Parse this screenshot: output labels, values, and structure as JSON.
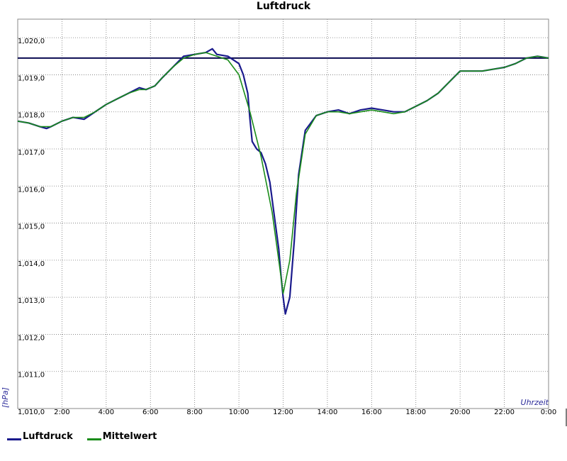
{
  "chart_data": {
    "type": "line",
    "title": "Luftdruck",
    "xlabel": "Uhrzeit",
    "ylabel": "[hPa]",
    "xlim": [
      0,
      24
    ],
    "ylim": [
      1010.0,
      1020.5
    ],
    "x_ticks": [
      {
        "value": 2,
        "label": "2:00"
      },
      {
        "value": 4,
        "label": "4:00"
      },
      {
        "value": 6,
        "label": "6:00"
      },
      {
        "value": 8,
        "label": "8:00"
      },
      {
        "value": 10,
        "label": "10:00"
      },
      {
        "value": 12,
        "label": "12:00"
      },
      {
        "value": 14,
        "label": "14:00"
      },
      {
        "value": 16,
        "label": "16:00"
      },
      {
        "value": 18,
        "label": "18:00"
      },
      {
        "value": 20,
        "label": "20:00"
      },
      {
        "value": 22,
        "label": "22:00"
      },
      {
        "value": 24,
        "label": "0:00"
      }
    ],
    "y_ticks": [
      {
        "value": 1010,
        "label": "1,010,0"
      },
      {
        "value": 1011,
        "label": "1,011,0"
      },
      {
        "value": 1012,
        "label": "1,012,0"
      },
      {
        "value": 1013,
        "label": "1,013,0"
      },
      {
        "value": 1014,
        "label": "1,014,0"
      },
      {
        "value": 1015,
        "label": "1,015,0"
      },
      {
        "value": 1016,
        "label": "1,016,0"
      },
      {
        "value": 1017,
        "label": "1,017,0"
      },
      {
        "value": 1018,
        "label": "1,018,0"
      },
      {
        "value": 1019,
        "label": "1,019,0"
      },
      {
        "value": 1020,
        "label": "1,020,0"
      }
    ],
    "grid": true,
    "reference_line": 1019.45,
    "legend_position": "bottom-left",
    "series": [
      {
        "name": "Luftdruck",
        "color": "#1a1a8c",
        "x": [
          0,
          0.5,
          1,
          1.3,
          1.5,
          2,
          2.5,
          3,
          3.5,
          4,
          4.5,
          5,
          5.5,
          5.8,
          6.2,
          6.5,
          7,
          7.5,
          8,
          8.5,
          8.8,
          9,
          9.5,
          10,
          10.2,
          10.4,
          10.5,
          10.6,
          10.8,
          11,
          11.2,
          11.4,
          11.6,
          11.8,
          11.9,
          12,
          12.1,
          12.3,
          12.5,
          12.7,
          13,
          13.5,
          14,
          14.5,
          15,
          15.5,
          16,
          16.5,
          17,
          17.5,
          18,
          18.5,
          19,
          19.5,
          20,
          20.5,
          21,
          21.5,
          22,
          22.5,
          23,
          23.5,
          24
        ],
        "y": [
          1017.75,
          1017.7,
          1017.6,
          1017.55,
          1017.6,
          1017.75,
          1017.85,
          1017.8,
          1018.0,
          1018.2,
          1018.35,
          1018.5,
          1018.65,
          1018.6,
          1018.7,
          1018.9,
          1019.2,
          1019.5,
          1019.55,
          1019.6,
          1019.7,
          1019.55,
          1019.5,
          1019.3,
          1019.0,
          1018.5,
          1017.8,
          1017.2,
          1017.0,
          1016.9,
          1016.6,
          1016.1,
          1015.2,
          1014.3,
          1013.6,
          1013.0,
          1012.55,
          1013.0,
          1014.5,
          1016.3,
          1017.5,
          1017.9,
          1018.0,
          1018.05,
          1017.95,
          1018.05,
          1018.1,
          1018.05,
          1018.0,
          1018.0,
          1018.15,
          1018.3,
          1018.5,
          1018.8,
          1019.1,
          1019.1,
          1019.1,
          1019.15,
          1019.2,
          1019.3,
          1019.45,
          1019.5,
          1019.45
        ]
      },
      {
        "name": "Mittelwert",
        "color": "#1a8c1a",
        "x": [
          0,
          0.5,
          1,
          1.5,
          2,
          2.5,
          3,
          3.5,
          4,
          4.5,
          5,
          5.5,
          5.8,
          6.2,
          6.5,
          7,
          7.5,
          8,
          8.5,
          9,
          9.5,
          10,
          10.5,
          11,
          11.5,
          11.8,
          12.0,
          12.3,
          12.6,
          13,
          13.5,
          14,
          14.5,
          15,
          15.5,
          16,
          16.5,
          17,
          17.5,
          18,
          18.5,
          19,
          19.5,
          20,
          20.5,
          21,
          21.5,
          22,
          22.5,
          23,
          23.5,
          24
        ],
        "y": [
          1017.75,
          1017.7,
          1017.6,
          1017.6,
          1017.75,
          1017.85,
          1017.85,
          1018.0,
          1018.2,
          1018.35,
          1018.5,
          1018.6,
          1018.6,
          1018.7,
          1018.9,
          1019.2,
          1019.45,
          1019.55,
          1019.6,
          1019.5,
          1019.4,
          1019.0,
          1018.0,
          1016.8,
          1015.3,
          1014.0,
          1013.1,
          1014.0,
          1015.8,
          1017.4,
          1017.9,
          1018.0,
          1018.0,
          1017.95,
          1018.0,
          1018.05,
          1018.0,
          1017.95,
          1018.0,
          1018.15,
          1018.3,
          1018.5,
          1018.8,
          1019.1,
          1019.1,
          1019.1,
          1019.15,
          1019.2,
          1019.3,
          1019.45,
          1019.5,
          1019.45
        ]
      }
    ]
  }
}
